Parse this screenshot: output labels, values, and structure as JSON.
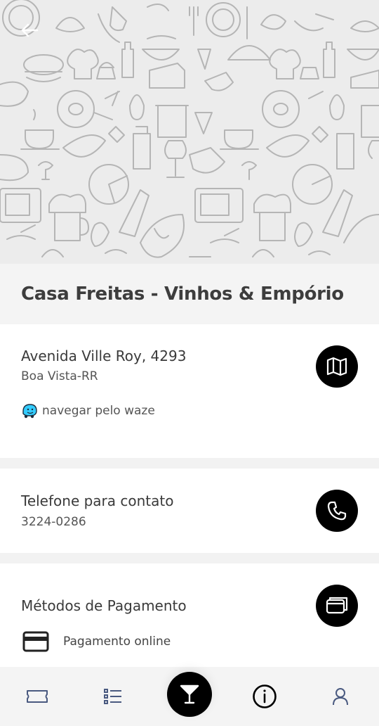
{
  "store": {
    "name": "Casa Freitas - Vinhos & Empório"
  },
  "address": {
    "street": "Avenida Ville Roy, 4293",
    "city": "Boa Vista-RR",
    "waze_label": "navegar pelo waze"
  },
  "contact": {
    "title": "Telefone para contato",
    "phone": "3224-0286"
  },
  "payment": {
    "title": "Métodos de Pagamento",
    "methods": [
      {
        "label": "Pagamento online"
      }
    ]
  },
  "icons": {
    "back": "arrow-left-icon",
    "map": "map-icon",
    "waze": "waze-icon",
    "phone": "phone-icon",
    "payment": "wallet-icon",
    "card": "credit-card-icon",
    "nav": [
      "ticket-icon",
      "list-icon",
      "cocktail-icon",
      "info-icon",
      "user-icon"
    ]
  },
  "colors": {
    "accent": "#000000",
    "waze": "#33ccff"
  }
}
